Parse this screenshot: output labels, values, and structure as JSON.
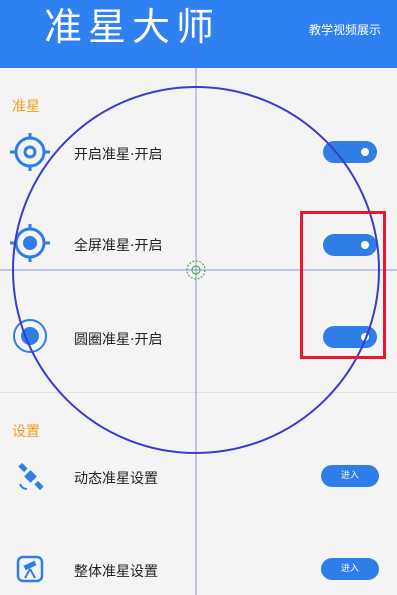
{
  "header": {
    "title": "准星大师",
    "tutorial_link": "教学视频展示",
    "background_color": "#2f80f0"
  },
  "sections": {
    "crosshair_label": "准星",
    "settings_label": "设置"
  },
  "crosshair_rows": [
    {
      "label": "开启准星·开启",
      "icon": "target-icon",
      "enabled": true
    },
    {
      "label": "全屏准星·开启",
      "icon": "fullscreen-crosshair-icon",
      "enabled": true
    },
    {
      "label": "圆圈准星·开启",
      "icon": "circle-crosshair-icon",
      "enabled": true
    }
  ],
  "settings_rows": [
    {
      "label": "动态准星设置",
      "icon": "satellite-icon",
      "button": "进入"
    },
    {
      "label": "整体准星设置",
      "icon": "telescope-icon",
      "button": "进入"
    }
  ],
  "colors": {
    "accent": "#2f7ee8",
    "section_label": "#f0a020",
    "highlight": "#e8192c",
    "overlay_circle": "#3a3ad0"
  }
}
